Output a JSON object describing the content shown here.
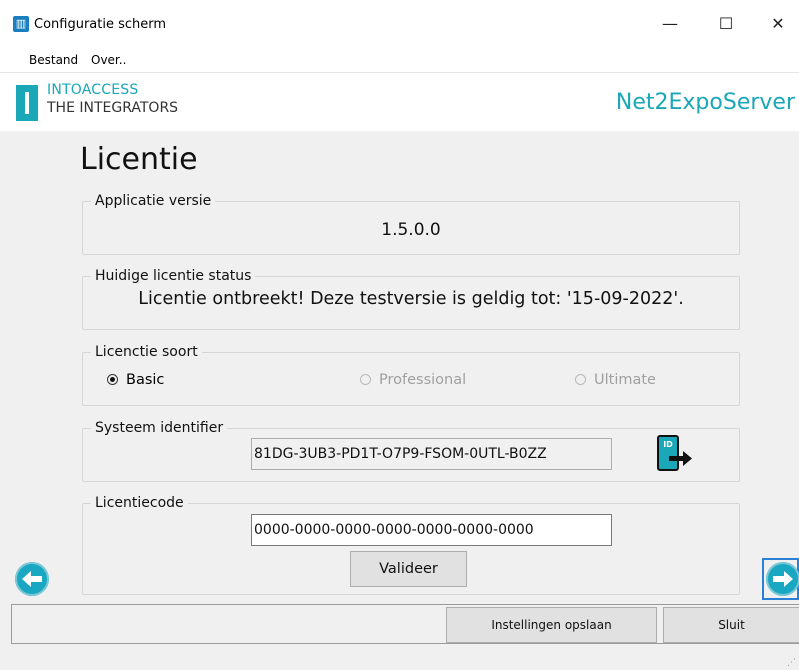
{
  "window": {
    "title": "Configuratie scherm",
    "controls": {
      "minimize": "—",
      "maximize": "☐",
      "close": "✕"
    }
  },
  "menu": {
    "items": [
      "Bestand",
      "Over.."
    ]
  },
  "header": {
    "company_line1": "INTOACCESS",
    "company_line2": "THE INTEGRATORS",
    "product": "Net2ExpoServer"
  },
  "page": {
    "title": "Licentie"
  },
  "version": {
    "label": "Applicatie versie",
    "value": "1.5.0.0"
  },
  "status": {
    "label": "Huidige licentie status",
    "value": "Licentie ontbreekt! Deze testversie is geldig tot: '15-09-2022'."
  },
  "license_type": {
    "label": "Licenctie soort",
    "options": [
      {
        "label": "Basic",
        "selected": true,
        "enabled": true
      },
      {
        "label": "Professional",
        "selected": false,
        "enabled": false
      },
      {
        "label": "Ultimate",
        "selected": false,
        "enabled": false
      }
    ]
  },
  "system_id": {
    "label": "Systeem identifier",
    "value": "81DG-3UB3-PD1T-O7P9-FSOM-0UTL-B0ZZ",
    "icon_text": "ID"
  },
  "license_code": {
    "label": "Licentiecode",
    "value": "0000-0000-0000-0000-0000-0000-0000",
    "validate_label": "Valideer"
  },
  "toolbar": {
    "save_label": "Instellingen opslaan",
    "close_label": "Sluit"
  },
  "colors": {
    "accent": "#1aa7b7",
    "nav": "#1aa7c2",
    "focus": "#2b7fd6"
  }
}
